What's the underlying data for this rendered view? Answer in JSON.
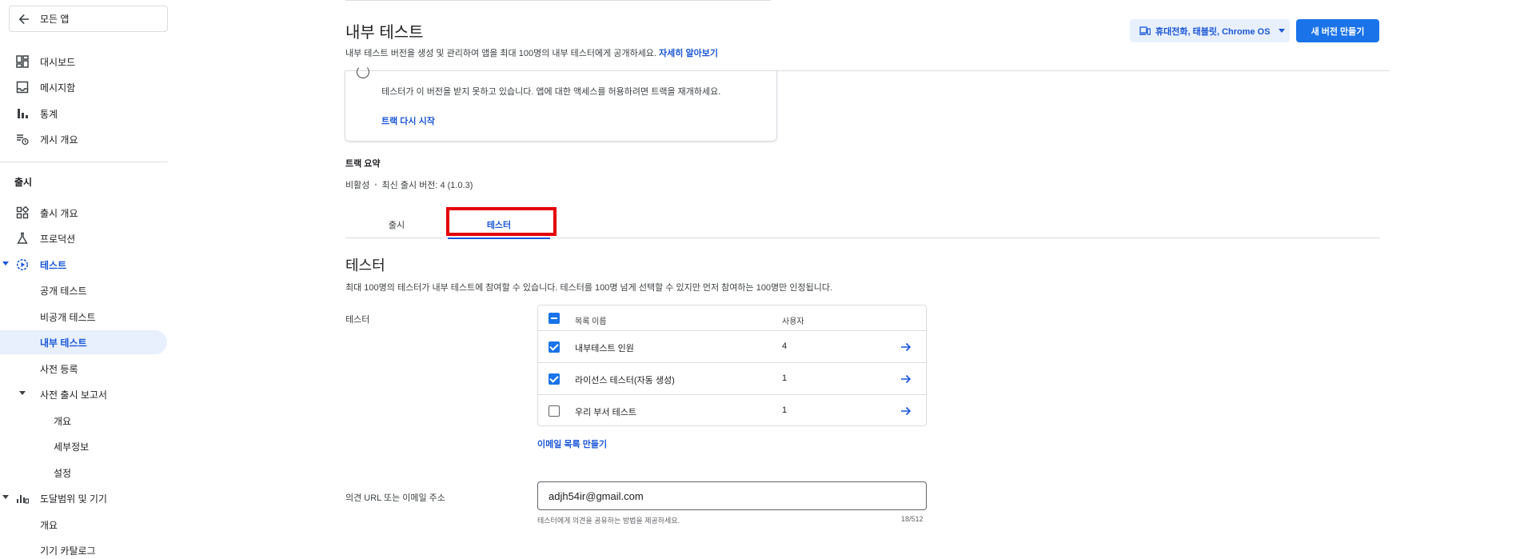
{
  "sidebar": {
    "back_label": "모든 앱",
    "items": [
      {
        "label": "대시보드",
        "icon": "dashboard-icon"
      },
      {
        "label": "메시지함",
        "icon": "inbox-icon"
      },
      {
        "label": "통계",
        "icon": "bar-chart-icon"
      },
      {
        "label": "게시 개요",
        "icon": "publish-history-icon"
      }
    ],
    "release_section": "출시",
    "release_items": [
      {
        "label": "출시 개요",
        "icon": "release-overview-icon"
      },
      {
        "label": "프로덕션",
        "icon": "production-icon"
      },
      {
        "label": "테스트",
        "icon": "testing-icon"
      }
    ],
    "testing_children": [
      "공개 테스트",
      "비공개 테스트",
      "내부 테스트",
      "사전 등록"
    ],
    "prelaunch_report": {
      "label": "사전 출시 보고서",
      "children": [
        "개요",
        "세부정보",
        "설정"
      ]
    },
    "reach_devices": {
      "label": "도달범위 및 기기",
      "icon": "reach-chart-icon",
      "children": [
        "개요",
        "기기 카탈로그"
      ]
    }
  },
  "header": {
    "title": "내부 테스트",
    "description": "내부 테스트 버전을 생성 및 관리하여 앱을 최대 100명의 내부 테스터에게 공개하세요.",
    "learn_more": "자세히 알아보기",
    "device_selector": "휴대전화, 태블릿, Chrome OS",
    "new_release_button": "새 버전 만들기"
  },
  "notice": {
    "text": "테스터가 이 버전을 받지 못하고 있습니다. 앱에 대한 액세스를 허용하려면 트랙을 재개하세요.",
    "restart_link": "트랙 다시 시작"
  },
  "track_summary": {
    "title": "트랙 요약",
    "status": "비활성",
    "latest_release": "최신 출시 버전: 4 (1.0.3)"
  },
  "tabs": [
    {
      "label": "출시",
      "active": false
    },
    {
      "label": "테스터",
      "active": true
    }
  ],
  "testers": {
    "title": "테스터",
    "description": "최대 100명의 테스터가 내부 테스트에 참여할 수 있습니다. 테스터를 100명 넘게 선택할 수 있지만 먼저 참여하는 100명만 인정됩니다.",
    "field_label": "테스터",
    "columns": {
      "name": "목록 이름",
      "users": "사용자"
    },
    "lists": [
      {
        "name": "내부테스트 인원",
        "users": "4",
        "checked": true
      },
      {
        "name": "라이선스 테스터(자동 생성)",
        "users": "1",
        "checked": true
      },
      {
        "name": "우리 부서 테스트",
        "users": "1",
        "checked": false
      }
    ],
    "create_email_list": "이메일 목록 만들기"
  },
  "feedback": {
    "label": "의견 URL 또는 이메일 주소",
    "value": "adjh54ir@gmail.com",
    "helper": "테스터에게 의견을 공유하는 방법을 제공하세요.",
    "counter": "18/512"
  },
  "colors": {
    "accent": "#1a73e8",
    "link": "#1a56d6",
    "highlight": "#e50000"
  }
}
